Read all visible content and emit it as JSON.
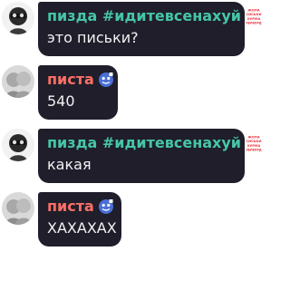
{
  "colors": {
    "bubble_bg": "#1f1e2a",
    "text": "#f2f2f4",
    "name_teal": "#46c6a6",
    "name_coral": "#ff6f66",
    "badge_red": "#e8323c"
  },
  "messages": [
    {
      "sender": "пизда #идитевсенахуй",
      "text": "это письки?",
      "badge_icon": "text-sticker-icon",
      "badge_lines": [
        "ЖОПА",
        "СИСЬКИ",
        "ХУРМА",
        "ХЕРВОРД"
      ]
    },
    {
      "sender": "писта",
      "text": "540",
      "badge_icon": "emoji-sticker-icon"
    },
    {
      "sender": "пизда #идитевсенахуй",
      "text": "какая",
      "badge_icon": "text-sticker-icon",
      "badge_lines": [
        "ЖОПА",
        "СИСЬКИ",
        "ХУРМА",
        "ХЕРВОРД"
      ]
    },
    {
      "sender": "писта",
      "text": "ХАХАХАХ",
      "badge_icon": "emoji-sticker-icon"
    }
  ]
}
